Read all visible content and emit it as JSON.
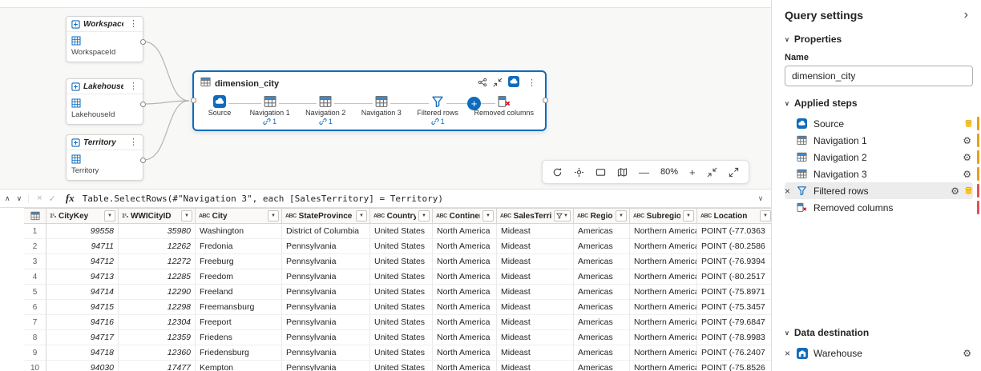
{
  "canvas": {
    "parameters": [
      {
        "title": "WorkspaceId",
        "label": "WorkspaceId"
      },
      {
        "title": "LakehouseId",
        "label": "LakehouseId"
      },
      {
        "title": "Territory",
        "label": "Territory"
      }
    ],
    "query_node": {
      "title": "dimension_city",
      "steps": [
        {
          "label": "Source",
          "icon": "cloud",
          "references": ""
        },
        {
          "label": "Navigation 1",
          "icon": "table",
          "references": "1"
        },
        {
          "label": "Navigation 2",
          "icon": "table",
          "references": "1"
        },
        {
          "label": "Navigation 3",
          "icon": "table",
          "references": ""
        },
        {
          "label": "Filtered rows",
          "icon": "filter",
          "references": "1"
        },
        {
          "label": "Removed columns",
          "icon": "remove-columns",
          "references": ""
        }
      ]
    },
    "zoom_toolbar": {
      "zoom_out": "—",
      "zoom_level": "80%",
      "zoom_in": "+"
    }
  },
  "formula_bar": {
    "fx_label": "fx",
    "formula": "Table.SelectRows(#\"Navigation 3\", each [SalesTerritory] = Territory)"
  },
  "grid": {
    "type_icons": {
      "number": "1²₃",
      "text": "ABC"
    },
    "columns": [
      {
        "name": "CityKey",
        "type": "number",
        "filtered": false
      },
      {
        "name": "WWICityID",
        "type": "number",
        "filtered": false
      },
      {
        "name": "City",
        "type": "text",
        "filtered": false
      },
      {
        "name": "StateProvince",
        "type": "text",
        "filtered": false
      },
      {
        "name": "Country",
        "type": "text",
        "filtered": false
      },
      {
        "name": "Continent",
        "type": "text",
        "filtered": false
      },
      {
        "name": "SalesTerritory",
        "type": "text",
        "filtered": true
      },
      {
        "name": "Region",
        "type": "text",
        "filtered": false
      },
      {
        "name": "Subregion",
        "type": "text",
        "filtered": false
      },
      {
        "name": "Location",
        "type": "text",
        "filtered": false
      }
    ],
    "rows": [
      {
        "num": "1",
        "cells": [
          "99558",
          "35980",
          "Washington",
          "District of Columbia",
          "United States",
          "North America",
          "Mideast",
          "Americas",
          "Northern America",
          "POINT (-77.0363"
        ]
      },
      {
        "num": "2",
        "cells": [
          "94711",
          "12262",
          "Fredonia",
          "Pennsylvania",
          "United States",
          "North America",
          "Mideast",
          "Americas",
          "Northern America",
          "POINT (-80.2586"
        ]
      },
      {
        "num": "3",
        "cells": [
          "94712",
          "12272",
          "Freeburg",
          "Pennsylvania",
          "United States",
          "North America",
          "Mideast",
          "Americas",
          "Northern America",
          "POINT (-76.9394"
        ]
      },
      {
        "num": "4",
        "cells": [
          "94713",
          "12285",
          "Freedom",
          "Pennsylvania",
          "United States",
          "North America",
          "Mideast",
          "Americas",
          "Northern America",
          "POINT (-80.2517"
        ]
      },
      {
        "num": "5",
        "cells": [
          "94714",
          "12290",
          "Freeland",
          "Pennsylvania",
          "United States",
          "North America",
          "Mideast",
          "Americas",
          "Northern America",
          "POINT (-75.8971"
        ]
      },
      {
        "num": "6",
        "cells": [
          "94715",
          "12298",
          "Freemansburg",
          "Pennsylvania",
          "United States",
          "North America",
          "Mideast",
          "Americas",
          "Northern America",
          "POINT (-75.3457"
        ]
      },
      {
        "num": "7",
        "cells": [
          "94716",
          "12304",
          "Freeport",
          "Pennsylvania",
          "United States",
          "North America",
          "Mideast",
          "Americas",
          "Northern America",
          "POINT (-79.6847"
        ]
      },
      {
        "num": "8",
        "cells": [
          "94717",
          "12359",
          "Friedens",
          "Pennsylvania",
          "United States",
          "North America",
          "Mideast",
          "Americas",
          "Northern America",
          "POINT (-78.9983"
        ]
      },
      {
        "num": "9",
        "cells": [
          "94718",
          "12360",
          "Friedensburg",
          "Pennsylvania",
          "United States",
          "North America",
          "Mideast",
          "Americas",
          "Northern America",
          "POINT (-76.2407"
        ]
      },
      {
        "num": "10",
        "cells": [
          "94030",
          "17477",
          "Kempton",
          "Pennsylvania",
          "United States",
          "North America",
          "Mideast",
          "Americas",
          "Northern America",
          "POINT (-75.8526"
        ]
      }
    ]
  },
  "query_settings": {
    "title": "Query settings",
    "collapse_icon": "›",
    "sections": {
      "properties": "Properties",
      "applied_steps": "Applied steps",
      "data_destination": "Data destination"
    },
    "name_label": "Name",
    "name_value": "dimension_city",
    "applied_steps": [
      {
        "label": "Source",
        "icon": "cloud",
        "gear": false,
        "indicator": true,
        "selected": false,
        "removable": false,
        "fold": "#e3a21a"
      },
      {
        "label": "Navigation 1",
        "icon": "table",
        "gear": true,
        "indicator": false,
        "selected": false,
        "removable": false,
        "fold": "#e3a21a"
      },
      {
        "label": "Navigation 2",
        "icon": "table",
        "gear": true,
        "indicator": false,
        "selected": false,
        "removable": false,
        "fold": "#e3a21a"
      },
      {
        "label": "Navigation 3",
        "icon": "table",
        "gear": true,
        "indicator": false,
        "selected": false,
        "removable": false,
        "fold": "#e3a21a"
      },
      {
        "label": "Filtered rows",
        "icon": "filter",
        "gear": true,
        "indicator": true,
        "selected": true,
        "removable": true,
        "fold": "#e05252"
      },
      {
        "label": "Removed columns",
        "icon": "remove-columns",
        "gear": false,
        "indicator": false,
        "selected": false,
        "removable": false,
        "fold": "#e05252"
      }
    ],
    "destination": {
      "label": "Warehouse"
    }
  }
}
